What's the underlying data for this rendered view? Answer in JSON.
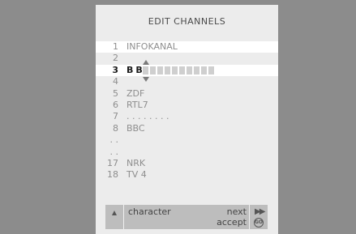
{
  "menu": {
    "title": "EDIT  CHANNELS",
    "channels": [
      {
        "number": "1",
        "name": "INFOKANAL"
      },
      {
        "number": "2",
        "name": ""
      },
      {
        "number": "3",
        "name": "B B",
        "editing": true
      },
      {
        "number": "4",
        "name": ""
      },
      {
        "number": "5",
        "name": "ZDF"
      },
      {
        "number": "6",
        "name": "RTL7"
      },
      {
        "number": "7",
        "name": ". . . . . . . ."
      },
      {
        "number": "8",
        "name": "BBC"
      },
      {
        "number": ". .",
        "name": ""
      },
      {
        "number": ". .",
        "name": ""
      },
      {
        "number": "17",
        "name": "NRK"
      },
      {
        "number": "18",
        "name": "TV 4"
      }
    ],
    "edit_chars": [
      "B",
      "B"
    ]
  },
  "footer": {
    "char_label": "character",
    "next_label": "next",
    "accept_label": "accept",
    "go_label": "GO"
  },
  "colors": {
    "background": "#8c8c8c",
    "panel": "#ececec",
    "highlight": "#ffffff",
    "slot": "#cfcfcf",
    "footer": "#bdbdbd"
  }
}
